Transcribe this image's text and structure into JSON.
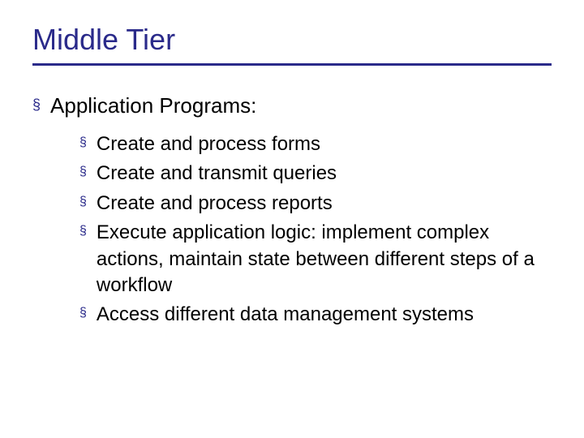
{
  "title": "Middle Tier",
  "outer": {
    "bullet": "§",
    "text": "Application Programs:"
  },
  "inner": {
    "bullet": "§",
    "items": [
      "Create and process forms",
      "Create and transmit queries",
      "Create and process reports",
      "Execute application logic: implement complex actions, maintain state between different steps of a workflow",
      "Access different data management systems"
    ]
  }
}
